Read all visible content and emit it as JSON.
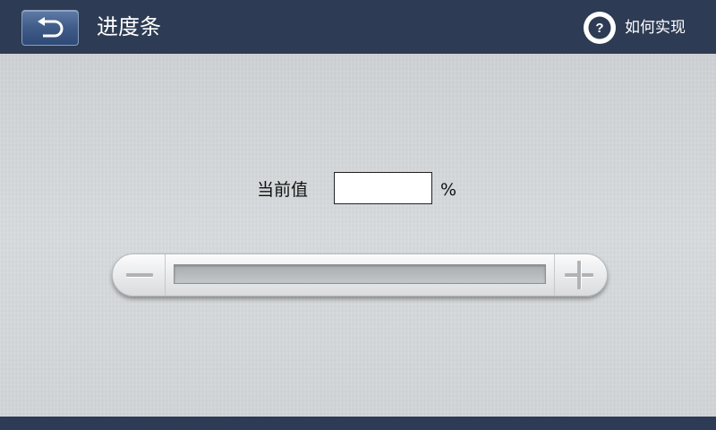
{
  "header": {
    "title": "进度条",
    "back_icon": "back-arrow-icon",
    "help_label": "如何实现",
    "help_icon": "question-circle-icon",
    "help_icon_glyph": "?"
  },
  "form": {
    "current_value_label": "当前值",
    "current_value": "",
    "unit": "%"
  },
  "slider": {
    "progress_percent": 0,
    "minus_icon": "minus-icon",
    "plus_icon": "plus-icon"
  },
  "colors": {
    "header_bg": "#2d3b54",
    "back_button": "#4a6695",
    "content_bg": "#d3d6d8"
  }
}
